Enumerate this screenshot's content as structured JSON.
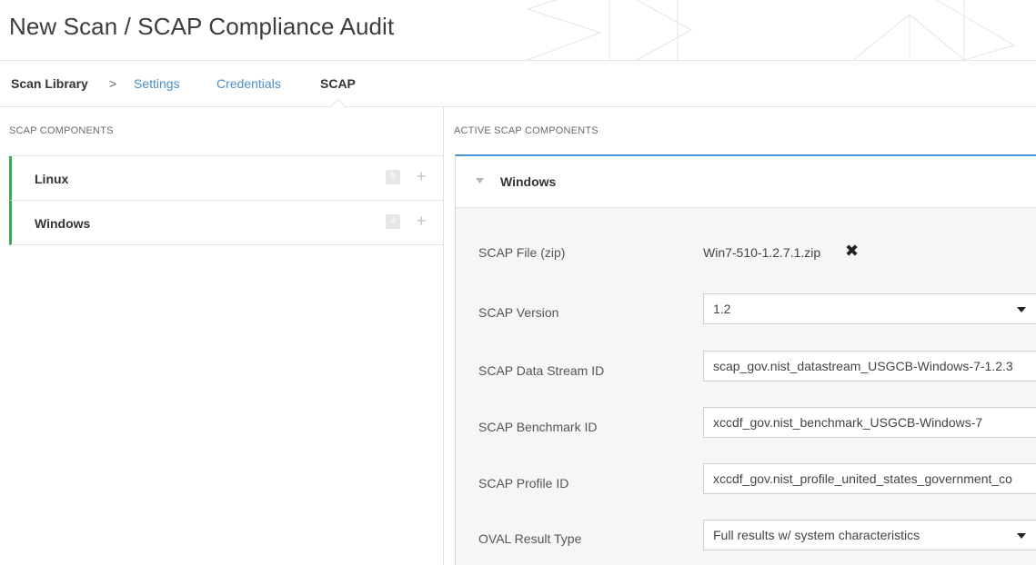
{
  "header": {
    "title": "New Scan / SCAP Compliance Audit"
  },
  "nav": {
    "library": "Scan Library",
    "separator": ">",
    "tabs": [
      "Settings",
      "Credentials",
      "SCAP"
    ],
    "active_tab": "SCAP"
  },
  "left": {
    "section_label": "SCAP COMPONENTS",
    "components": [
      {
        "name": "Linux",
        "count": "5",
        "add": "+"
      },
      {
        "name": "Windows",
        "count": "4",
        "add": "+"
      }
    ]
  },
  "right": {
    "section_label": "ACTIVE SCAP COMPONENTS",
    "card": {
      "title": "Windows",
      "fields": {
        "file_label": "SCAP File (zip)",
        "file_value": "Win7-510-1.2.7.1.zip",
        "version_label": "SCAP Version",
        "version_value": "1.2",
        "datastream_label": "SCAP Data Stream ID",
        "datastream_value": "scap_gov.nist_datastream_USGCB-Windows-7-1.2.3",
        "benchmark_label": "SCAP Benchmark ID",
        "benchmark_value": "xccdf_gov.nist_benchmark_USGCB-Windows-7",
        "profile_label": "SCAP Profile ID",
        "profile_value": "xccdf_gov.nist_profile_united_states_government_co",
        "oval_label": "OVAL Result Type",
        "oval_value": "Full results w/ system characteristics"
      }
    }
  },
  "colors": {
    "accent_green": "#3aa856",
    "link_blue": "#4a90c8",
    "card_border_top": "#4a90d9"
  },
  "icons": {
    "breadcrumb_separator": "chevron-right-icon",
    "add": "plus-icon",
    "collapse": "caret-down-icon",
    "remove_file": "close-icon",
    "select": "dropdown-caret-icon"
  }
}
